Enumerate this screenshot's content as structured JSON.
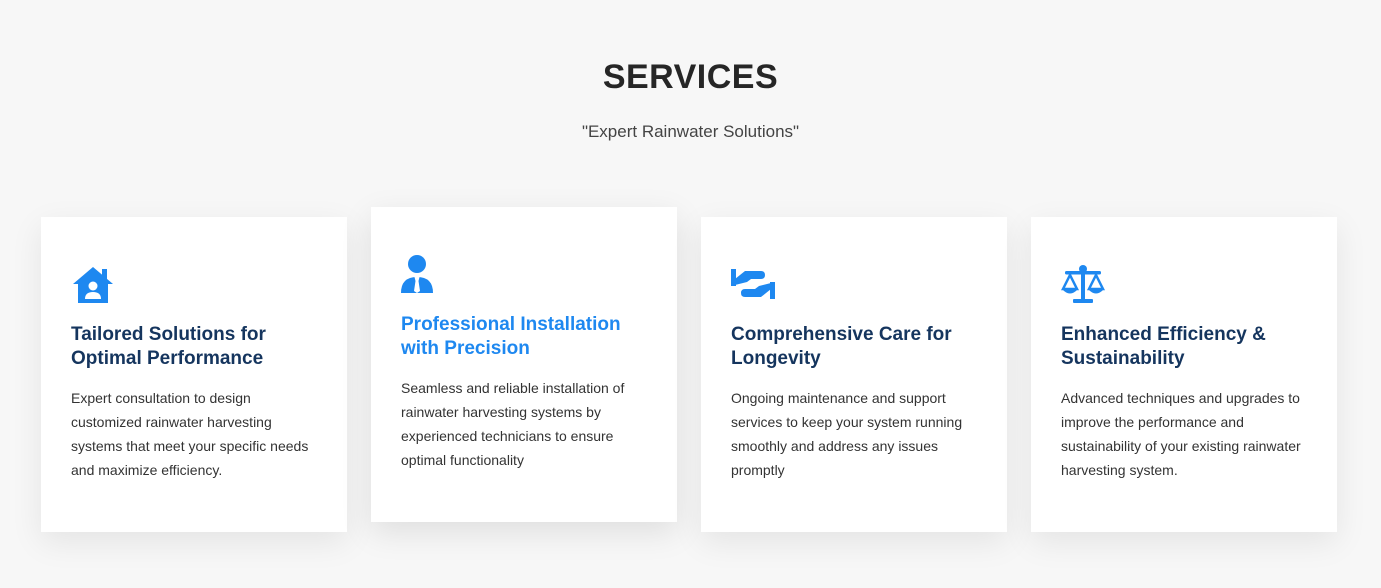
{
  "section": {
    "title": "SERVICES",
    "subtitle": "\"Expert Rainwater Solutions\""
  },
  "colors": {
    "accent": "#1e88f0",
    "card_title": "#15355e",
    "background": "#f7f7f7"
  },
  "cards": [
    {
      "icon": "house-user-icon",
      "title": "Tailored Solutions for Optimal Performance",
      "text": "Expert consultation to design customized rainwater harvesting systems that meet your specific needs and maximize efficiency."
    },
    {
      "icon": "user-tie-icon",
      "title": "Professional Installation with Precision",
      "text": "Seamless and reliable installation of rainwater harvesting systems by experienced technicians to ensure optimal functionality"
    },
    {
      "icon": "hands-icon",
      "title": "Comprehensive Care for Longevity",
      "text": "Ongoing maintenance and support services to keep your system running smoothly and address any issues promptly"
    },
    {
      "icon": "balance-scale-icon",
      "title": "Enhanced Efficiency & Sustainability",
      "text": "Advanced techniques and upgrades to improve the performance and sustainability of your existing rainwater harvesting system."
    }
  ]
}
